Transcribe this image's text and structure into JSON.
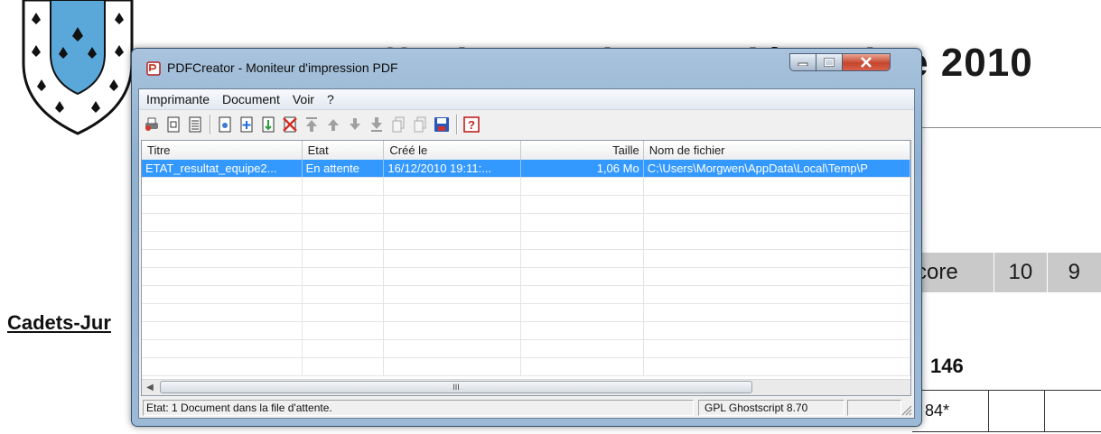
{
  "background": {
    "doc_title": "Coffe de Lannion 12 décembre 2010",
    "score_strip": [
      "core",
      "10",
      "9"
    ],
    "section_heading": "Cadets-Jur",
    "number": "146",
    "row_value": "84*"
  },
  "window": {
    "title": "PDFCreator - Moniteur d'impression PDF",
    "menu": [
      "Imprimante",
      "Document",
      "Voir",
      "?"
    ],
    "toolbar_icons": [
      "printer-icon",
      "document-icon",
      "list-icon",
      "open-document-icon",
      "add-document-icon",
      "combine-icon",
      "delete-icon",
      "move-top-icon",
      "move-up-icon",
      "move-down-icon",
      "move-bottom-icon",
      "duplicate-icon",
      "copy-icon",
      "save-icon",
      "help-icon"
    ],
    "columns": [
      "Titre",
      "Etat",
      "Créé le",
      "Taille",
      "Nom de fichier"
    ],
    "rows": [
      {
        "titre": "ETAT_resultat_equipe2...",
        "etat": "En attente",
        "cree": "16/12/2010 19:11:...",
        "taille": "1,06 Mo",
        "fichier": "C:\\Users\\Morgwen\\AppData\\Local\\Temp\\P"
      }
    ],
    "scroll_grip": "III",
    "status_left": "Etat: 1 Document dans la file d'attente.",
    "status_right": "GPL Ghostscript 8.70"
  },
  "colors": {
    "selection": "#3399ff",
    "titlebar": "#9cbad6",
    "close_button": "#c7462e"
  }
}
